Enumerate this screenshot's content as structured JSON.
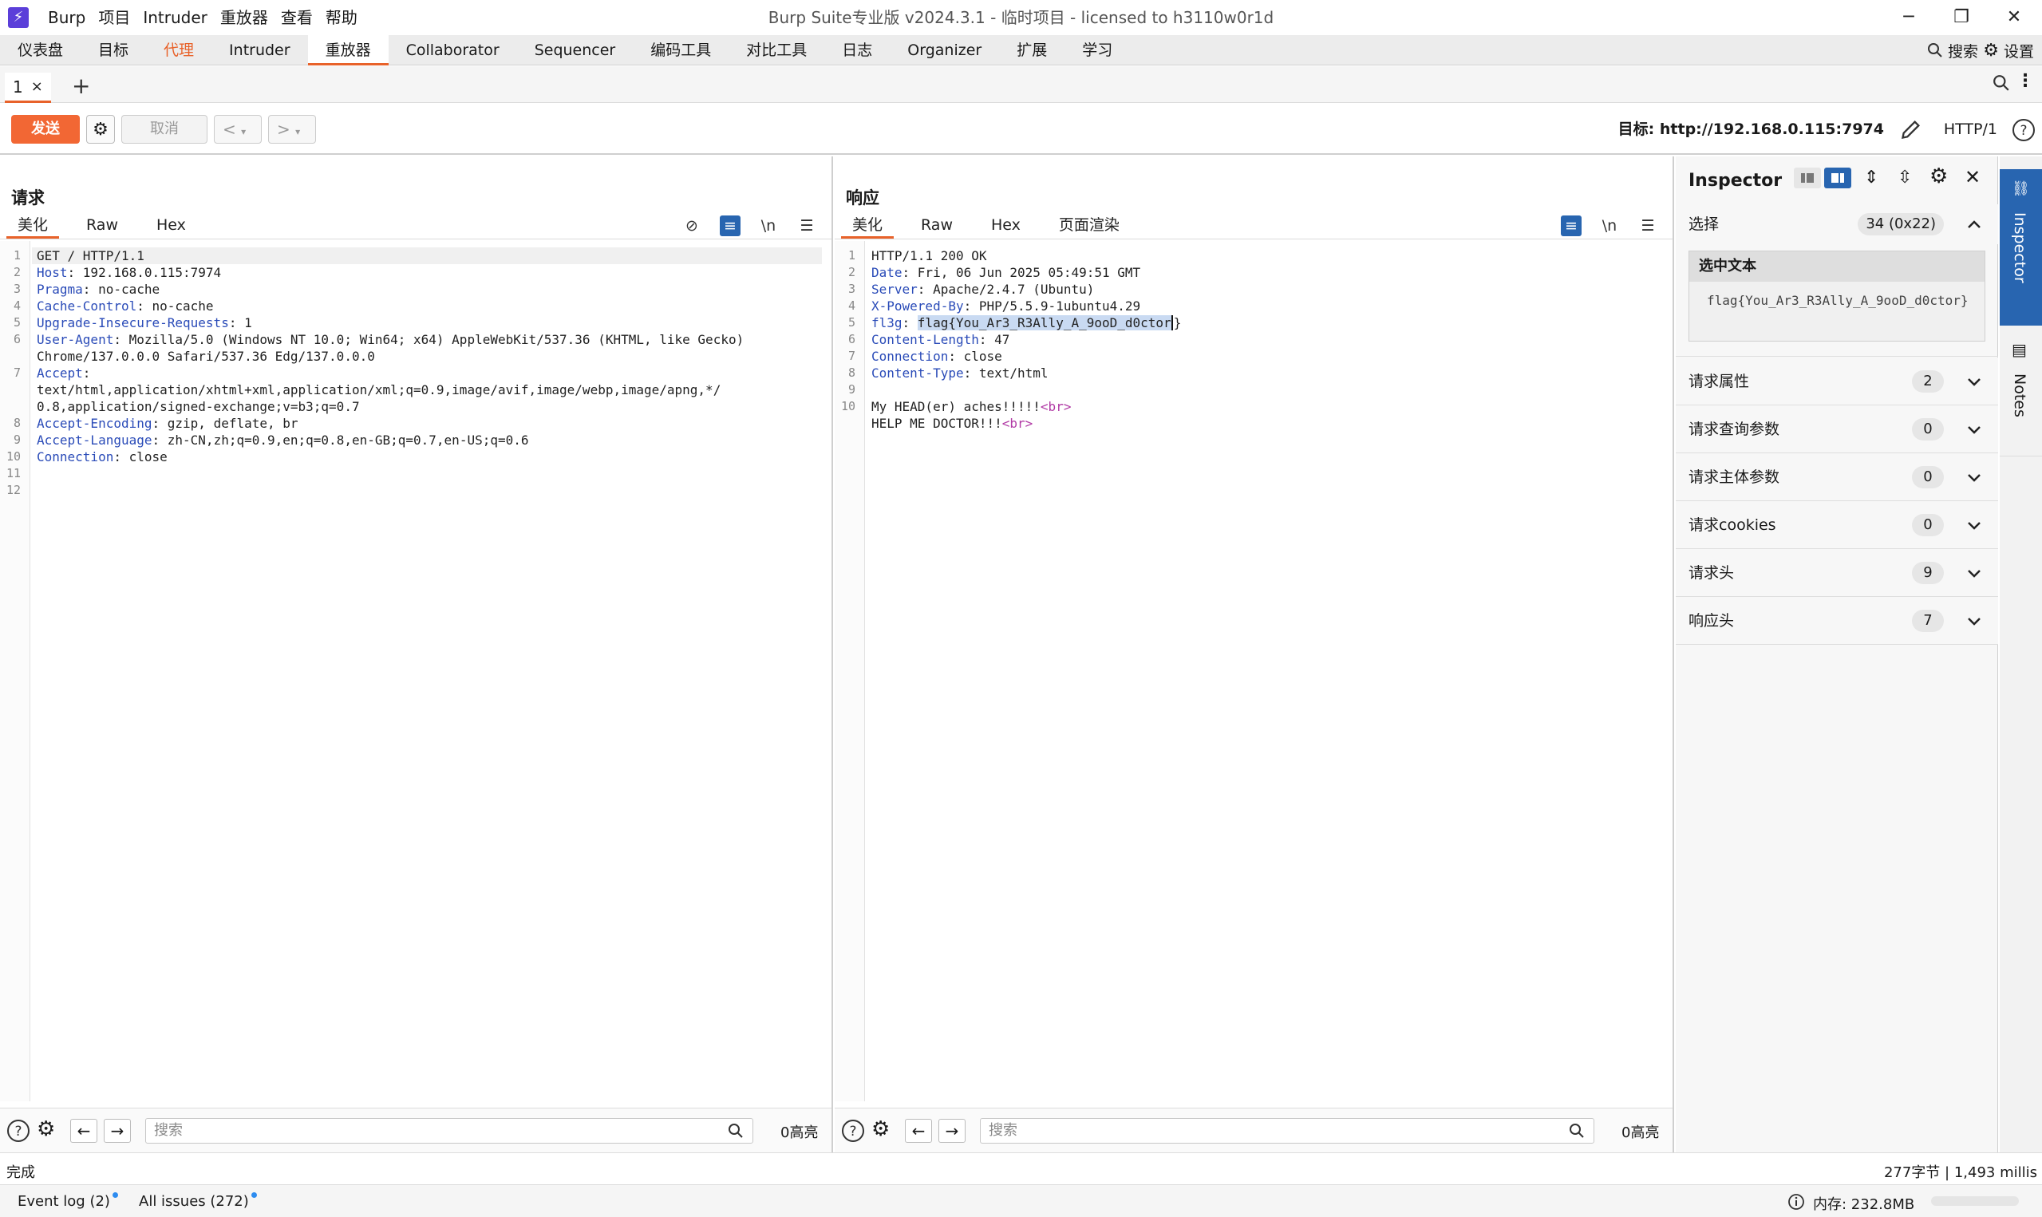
{
  "titlebar": {
    "menu": [
      "Burp",
      "项目",
      "Intruder",
      "重放器",
      "查看",
      "帮助"
    ],
    "title": "Burp Suite专业版  v2024.3.1 - 临时项目 - licensed to h3110w0r1d"
  },
  "main_tabs": [
    "仪表盘",
    "目标",
    "代理",
    "Intruder",
    "重放器",
    "Collaborator",
    "Sequencer",
    "编码工具",
    "对比工具",
    "日志",
    "Organizer",
    "扩展",
    "学习"
  ],
  "main_tabs_active": "重放器",
  "top_right": {
    "search": "搜索",
    "settings": "设置"
  },
  "subtab": {
    "label": "1",
    "close": "×"
  },
  "toolbar": {
    "send": "发送",
    "cancel": "取消",
    "target": "目标: http://192.168.0.115:7974",
    "http_version": "HTTP/1"
  },
  "request": {
    "title": "请求",
    "tabs": [
      "美化",
      "Raw",
      "Hex"
    ],
    "lines": [
      {
        "n": "1",
        "key": "",
        "val": "GET / HTTP/1.1"
      },
      {
        "n": "2",
        "key": "Host",
        "val": ": 192.168.0.115:7974"
      },
      {
        "n": "3",
        "key": "Pragma",
        "val": ": no-cache"
      },
      {
        "n": "4",
        "key": "Cache-Control",
        "val": ": no-cache"
      },
      {
        "n": "5",
        "key": "Upgrade-Insecure-Requests",
        "val": ": 1"
      },
      {
        "n": "6",
        "key": "User-Agent",
        "val": ": Mozilla/5.0 (Windows NT 10.0; Win64; x64) AppleWebKit/537.36 (KHTML, like Gecko)"
      },
      {
        "n": "",
        "key": "",
        "val": "Chrome/137.0.0.0 Safari/537.36 Edg/137.0.0.0"
      },
      {
        "n": "7",
        "key": "Accept",
        "val": ":"
      },
      {
        "n": "",
        "key": "",
        "val": "text/html,application/xhtml+xml,application/xml;q=0.9,image/avif,image/webp,image/apng,*/"
      },
      {
        "n": "",
        "key": "",
        "val": "0.8,application/signed-exchange;v=b3;q=0.7"
      },
      {
        "n": "8",
        "key": "Accept-Encoding",
        "val": ": gzip, deflate, br"
      },
      {
        "n": "9",
        "key": "Accept-Language",
        "val": ": zh-CN,zh;q=0.9,en;q=0.8,en-GB;q=0.7,en-US;q=0.6"
      },
      {
        "n": "10",
        "key": "Connection",
        "val": ": close"
      },
      {
        "n": "11",
        "key": "",
        "val": ""
      },
      {
        "n": "12",
        "key": "",
        "val": ""
      }
    ],
    "search_placeholder": "搜索",
    "highlights": "0高亮"
  },
  "response": {
    "title": "响应",
    "tabs": [
      "美化",
      "Raw",
      "Hex",
      "页面渲染"
    ],
    "lines": [
      {
        "n": "1",
        "key": "",
        "val": "HTTP/1.1 200 OK"
      },
      {
        "n": "2",
        "key": "Date",
        "val": ": Fri, 06 Jun 2025 05:49:51 GMT"
      },
      {
        "n": "3",
        "key": "Server",
        "val": ": Apache/2.4.7 (Ubuntu)"
      },
      {
        "n": "4",
        "key": "X-Powered-By",
        "val": ": PHP/5.5.9-1ubuntu4.29"
      },
      {
        "n": "5",
        "key": "fl3g",
        "val": ": ",
        "sel": "flag{You_Ar3_R3Ally_A_9ooD_d0ctor",
        "after": "}"
      },
      {
        "n": "6",
        "key": "Content-Length",
        "val": ": 47"
      },
      {
        "n": "7",
        "key": "Connection",
        "val": ": close"
      },
      {
        "n": "8",
        "key": "Content-Type",
        "val": ": text/html"
      },
      {
        "n": "9",
        "key": "",
        "val": ""
      },
      {
        "n": "10",
        "key": "",
        "val": "My HEAD(er) aches!!!!!",
        "tag": "<br>"
      },
      {
        "n": "",
        "key": "",
        "val": "HELP ME DOCTOR!!!",
        "tag": "<br>"
      }
    ],
    "search_placeholder": "搜索",
    "highlights": "0高亮"
  },
  "inspector": {
    "title": "Inspector",
    "selection_label": "选择",
    "selection_count": "34 (0x22)",
    "selected_text_heading": "选中文本",
    "selected_text": "flag{You_Ar3_R3Ally_A_9ooD_d0ctor}",
    "sections": [
      {
        "label": "请求属性",
        "count": "2"
      },
      {
        "label": "请求查询参数",
        "count": "0"
      },
      {
        "label": "请求主体参数",
        "count": "0"
      },
      {
        "label": "请求cookies",
        "count": "0"
      },
      {
        "label": "请求头",
        "count": "9"
      },
      {
        "label": "响应头",
        "count": "7"
      }
    ]
  },
  "rail": {
    "inspector": "Inspector",
    "notes": "Notes"
  },
  "status": {
    "left": "完成",
    "right": "277字节 | 1,493 millis"
  },
  "bottom": {
    "event_log": "Event log (2)",
    "issues": "All issues (272)",
    "memory": "内存: 232.8MB"
  },
  "colors": {
    "accent": "#e8622a",
    "blue": "#2865b0",
    "header_key": "#2a4bb8",
    "tag": "#b13aa5"
  }
}
